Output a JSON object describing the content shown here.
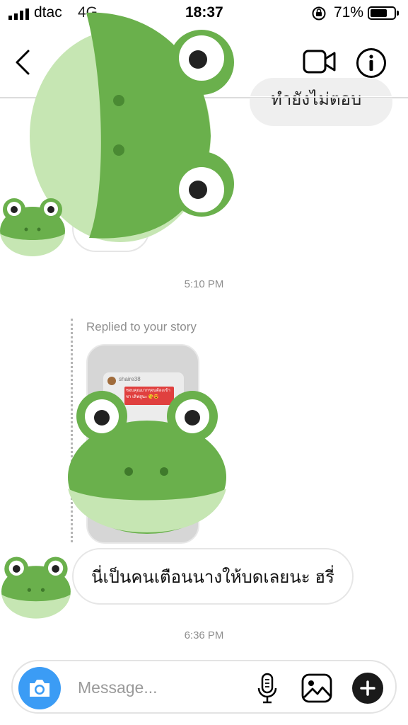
{
  "status_bar": {
    "carrier": "dtac",
    "network": "4G",
    "time": "18:37",
    "battery": "71%",
    "battery_level": 0.71
  },
  "nav": {
    "back_icon": "chevron-left-icon",
    "video_icon": "video-camera-icon",
    "info_icon": "info-icon"
  },
  "thread": {
    "sent_message_partial": "ทำยังไม่ตอบ",
    "timestamp_1": "5:10 PM",
    "story_reply_label": "Replied to your story",
    "story_card": {
      "username": "shaire38",
      "caption": "ชอบคุณมากๆจนต้องเข้า\nชา เลิฟสูนะ 😘😍"
    },
    "received_message": "นี่เป็นคนเตือนนางให้บดเลยนะ ฮรี่",
    "timestamp_2": "6:36 PM"
  },
  "composer": {
    "placeholder": "Message...",
    "camera_icon": "camera-icon",
    "mic_icon": "microphone-icon",
    "gallery_icon": "image-icon",
    "plus_icon": "plus-icon"
  },
  "colors": {
    "frog_dark": "#6ab04c",
    "frog_light": "#c6e6b3",
    "camera_blue": "#3b9cf5",
    "divider": "#dcdcdc"
  }
}
